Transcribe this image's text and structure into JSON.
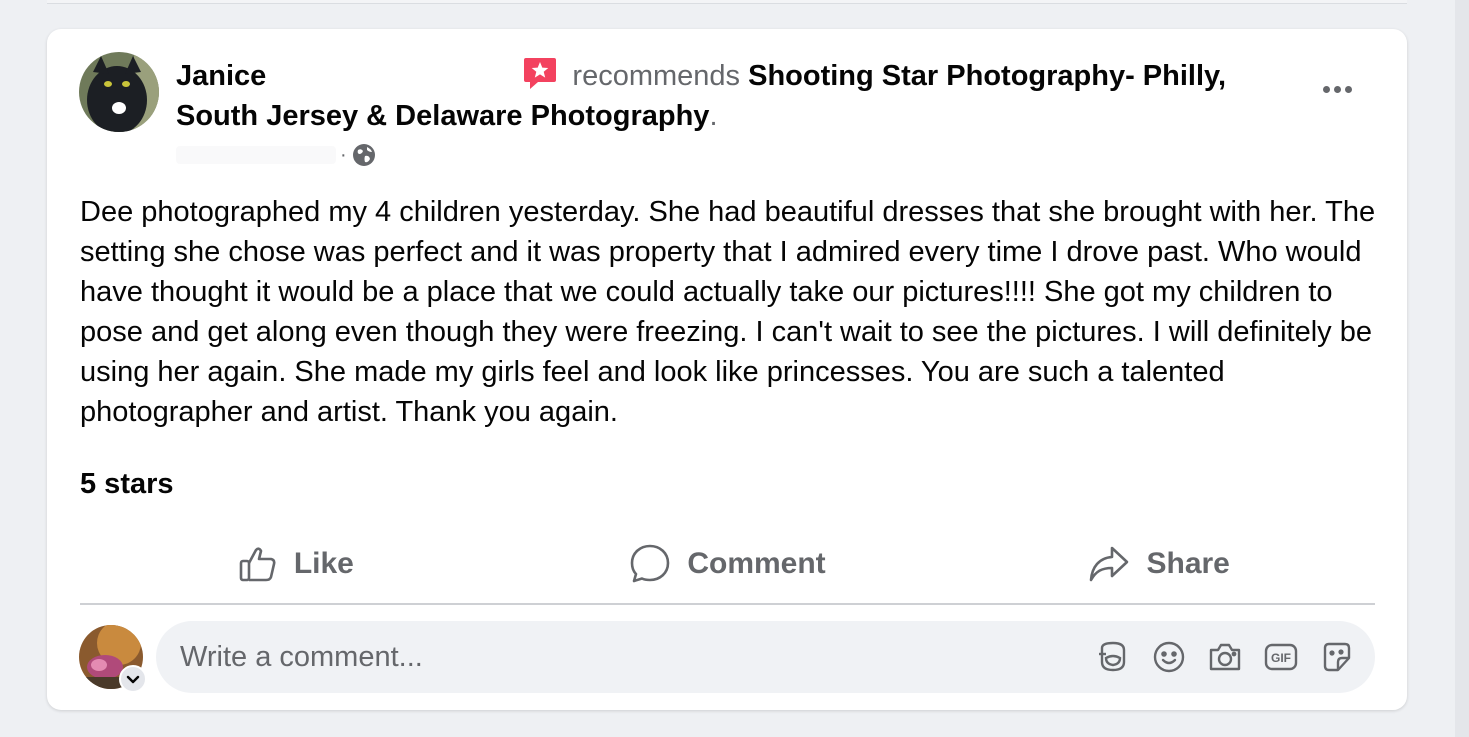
{
  "post": {
    "author": "Janice",
    "verb": "recommends",
    "page_name": "Shooting Star Photography- Philly, South Jersey & Delaware Photography",
    "page_suffix": ".",
    "meta_separator": "·",
    "audience_icon": "globe-icon",
    "body": "Dee photographed my 4 children yesterday.  She had beautiful dresses that she brought with her.  The setting she chose was perfect and it was property that I admired every time I drove past.  Who would have thought it would be a place that we could actually take our pictures!!!! She got my children to pose and get along even though they were freezing.  I can't wait to see the pictures.  I will definitely be using her again.  She made my girls feel and look like princesses.  You are such a talented photographer and artist.  Thank you again.",
    "rating_text": "5 stars"
  },
  "actions": {
    "like": "Like",
    "comment": "Comment",
    "share": "Share"
  },
  "composer": {
    "placeholder": "Write a comment...",
    "tools": [
      "avatar-sticker-icon",
      "emoji-icon",
      "camera-icon",
      "gif-icon",
      "sticker-icon"
    ]
  },
  "colors": {
    "recommend_badge": "#f3425f",
    "secondary_text": "#65676b",
    "card_bg": "#ffffff",
    "page_bg": "#eef0f3",
    "input_bg": "#f0f2f5"
  }
}
